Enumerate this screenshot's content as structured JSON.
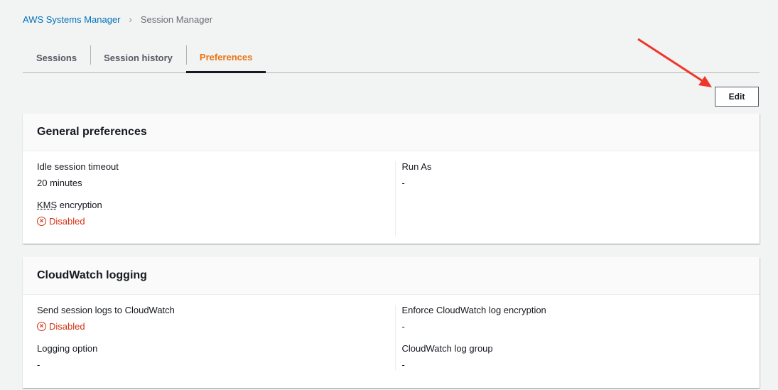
{
  "breadcrumb": {
    "root": "AWS Systems Manager",
    "current": "Session Manager"
  },
  "tabs": [
    {
      "label": "Sessions"
    },
    {
      "label": "Session history"
    },
    {
      "label": "Preferences"
    }
  ],
  "edit_label": "Edit",
  "general": {
    "title": "General preferences",
    "idle_label": "Idle session timeout",
    "idle_value": "20 minutes",
    "kms_label": "KMS",
    "kms_label_rest": " encryption",
    "kms_value": "Disabled",
    "runas_label": "Run As",
    "runas_value": "-"
  },
  "cloudwatch": {
    "title": "CloudWatch logging",
    "send_label": "Send session logs to CloudWatch",
    "send_value": "Disabled",
    "logopt_label": "Logging option",
    "logopt_value": "-",
    "enforce_label": "Enforce CloudWatch log encryption",
    "enforce_value": "-",
    "group_label": "CloudWatch log group",
    "group_value": "-"
  },
  "colors": {
    "accent": "#ec7211",
    "error": "#d13212",
    "link": "#0073bb",
    "arrow": "#f0352a"
  }
}
